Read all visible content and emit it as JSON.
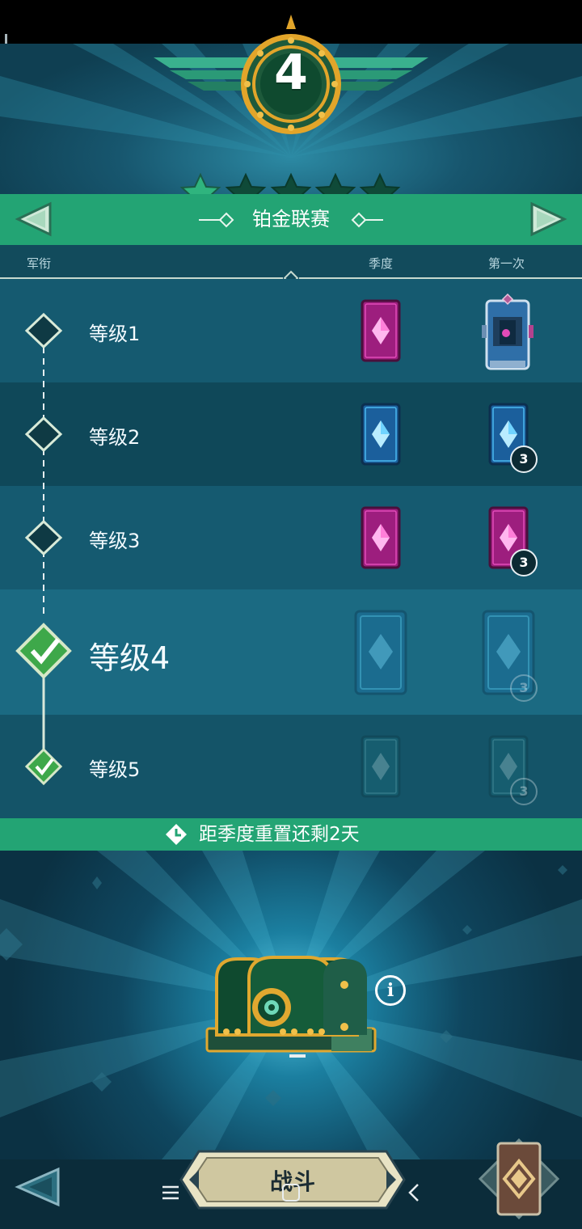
{
  "rank": {
    "number": "4",
    "stars_filled": 1,
    "stars_total": 5
  },
  "league": {
    "title": "铂金联赛"
  },
  "table": {
    "headers": {
      "rank": "军衔",
      "season": "季度",
      "first": "第一次"
    },
    "rows": [
      {
        "label": "等级1",
        "season_card": "pink",
        "first_reward": "reward-chest",
        "first_count": ""
      },
      {
        "label": "等级2",
        "season_card": "blue",
        "first_reward": "blue",
        "first_count": "3"
      },
      {
        "label": "等级3",
        "season_card": "pink",
        "first_reward": "pink",
        "first_count": "3"
      },
      {
        "label": "等级4",
        "season_card": "blue",
        "first_reward": "blue",
        "first_count": "3",
        "status": "current"
      },
      {
        "label": "等级5",
        "season_card": "blue",
        "first_reward": "blue",
        "first_count": "3",
        "status": "completed"
      }
    ]
  },
  "reset": {
    "text": "距季度重置还剩2天"
  },
  "bottom": {
    "battle_label": "战斗"
  },
  "colors": {
    "green_bar": "#23a474",
    "pink_card": "#b3268f",
    "blue_card": "#1e6fb0",
    "badge": "#0c2a33"
  },
  "icons": [
    "left-arrow-icon",
    "right-arrow-icon",
    "star-icon",
    "diamond-icon",
    "check-icon",
    "clock-icon",
    "info-icon",
    "chest-icon",
    "deck-icon",
    "menu-icon",
    "home-icon",
    "back-icon"
  ]
}
